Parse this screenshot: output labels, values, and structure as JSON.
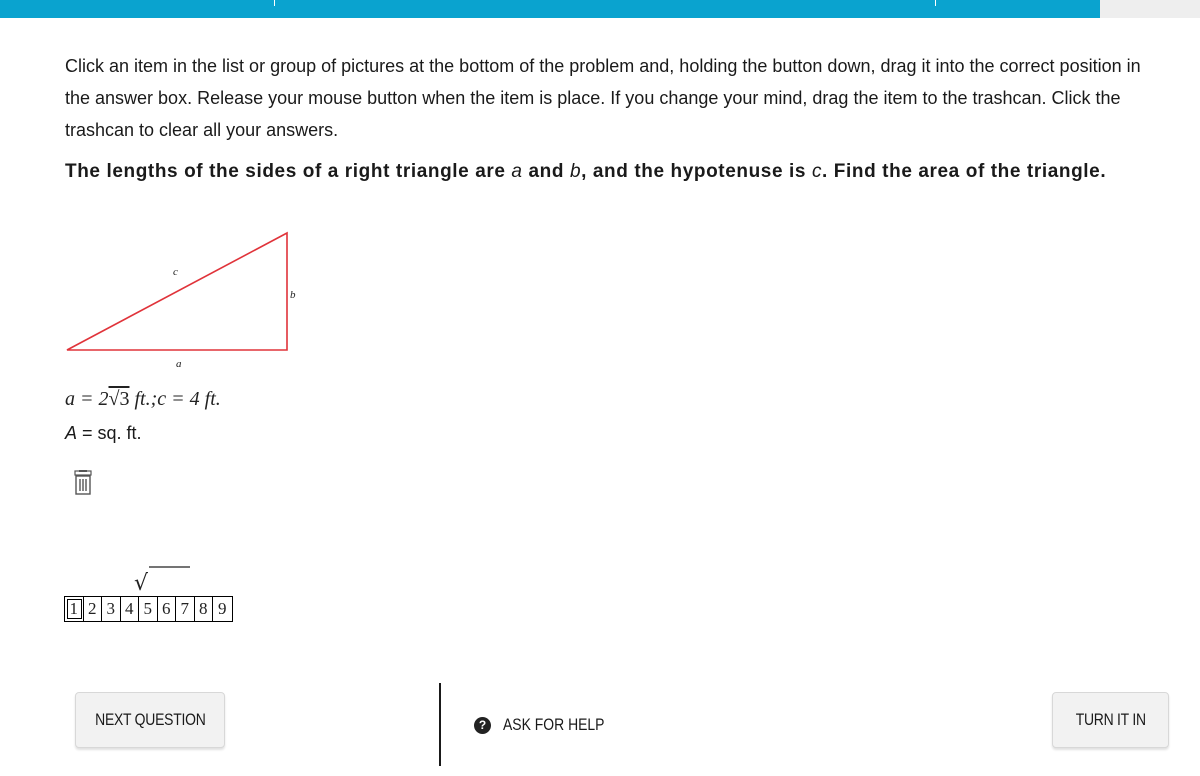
{
  "colors": {
    "topbar": "#0aa3cf",
    "triangle": "#e0333a"
  },
  "instructions": "Click an item in the list or group of pictures at the bottom of the problem and, holding the button down, drag it into the correct position in the answer box. Release your mouse button when the item is place. If you change your mind, drag the item to the trashcan. Click the trashcan to clear all your answers.",
  "question": {
    "part1": "The lengths of the sides of a right triangle are ",
    "var_a": "a",
    "part2": " and ",
    "var_b": "b",
    "part3": ", and the hypotenuse is ",
    "var_c": "c",
    "part4": ". Find the area of the triangle."
  },
  "diagram": {
    "label_c": "c",
    "label_b": "b",
    "label_a": "a"
  },
  "given": {
    "a_var": "a",
    "eq1": " = 2",
    "radical": "√3",
    "unit1": " ft.;",
    "c_var": "c",
    "eq2": " = 4",
    "unit2": " ft."
  },
  "answer": {
    "var": "A",
    "rest": " = sq. ft."
  },
  "trash_icon": "trash-icon",
  "palette": {
    "sqrt_symbol": "√",
    "digits": [
      "1",
      "2",
      "3",
      "4",
      "5",
      "6",
      "7",
      "8",
      "9"
    ]
  },
  "footer": {
    "next_label": "NEXT QUESTION",
    "help_label": "ASK FOR HELP",
    "help_icon": "?",
    "turn_label": "TURN IT IN"
  }
}
